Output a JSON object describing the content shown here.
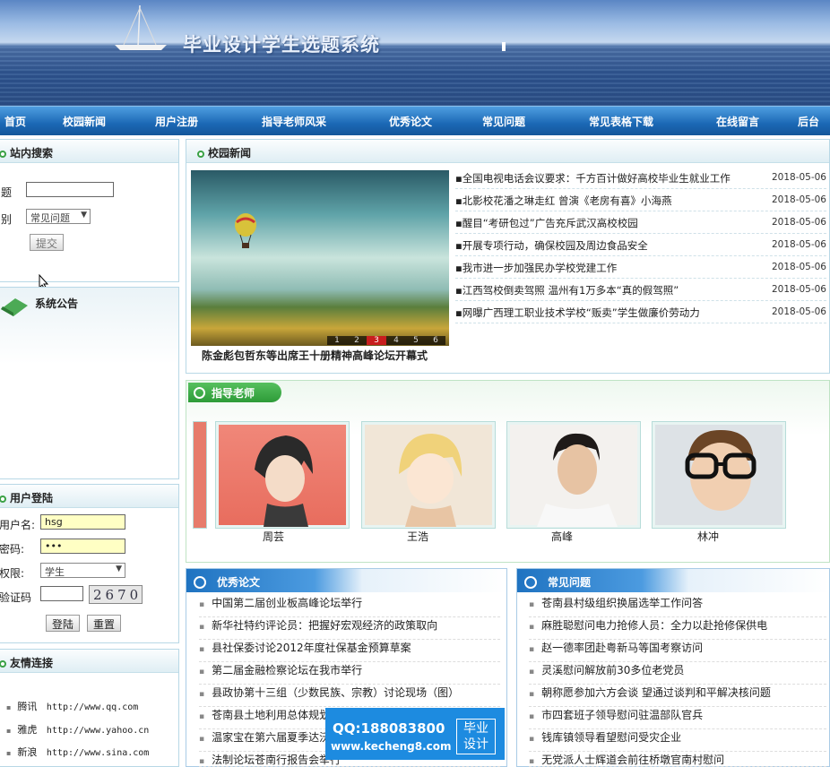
{
  "banner": {
    "title": "毕业设计学生选题系统"
  },
  "nav": [
    "首页",
    "校园新闻",
    "用户注册",
    "指导老师风采",
    "优秀论文",
    "常见问题",
    "常见表格下载",
    "在线留言",
    "后台"
  ],
  "search": {
    "title": "站内搜索",
    "label_title": "题",
    "label_type": "别",
    "type_value": "常见问题",
    "submit": "提交"
  },
  "notice": {
    "title": "系统公告"
  },
  "login": {
    "title": "用户登陆",
    "user_label": "用户名:",
    "user_value": "hsg",
    "pwd_label": "密码:",
    "pwd_value": "•••",
    "role_label": "权限:",
    "role_value": "学生",
    "code_label": "验证码",
    "captcha": "2670",
    "login_btn": "登陆",
    "reset_btn": "重置"
  },
  "links": {
    "title": "友情连接",
    "items": [
      {
        "name": "腾讯",
        "url": "http://www.qq.com"
      },
      {
        "name": "雅虎",
        "url": "http://www.yahoo.cn"
      },
      {
        "name": "新浪",
        "url": "http://www.sina.com"
      }
    ]
  },
  "news": {
    "title": "校园新闻",
    "caption": "陈金彪包哲东等出席王十册精神高峰论坛开幕式",
    "pager": [
      "1",
      "2",
      "3",
      "4",
      "5",
      "6"
    ],
    "items": [
      {
        "t": "▪全国电视电话会议要求：千方百计做好高校毕业生就业工作",
        "d": "2018-05-06"
      },
      {
        "t": "▪北影校花潘之琳走红 曾演《老房有喜》小海燕",
        "d": "2018-05-06"
      },
      {
        "t": "▪醒目“考研包过”广告充斥武汉高校校园",
        "d": "2018-05-06"
      },
      {
        "t": "▪开展专项行动，确保校园及周边食品安全",
        "d": "2018-05-06"
      },
      {
        "t": "▪我市进一步加强民办学校党建工作",
        "d": "2018-05-06"
      },
      {
        "t": "▪江西驾校倒卖驾照 温州有1万多本“真的假驾照”",
        "d": "2018-05-06"
      },
      {
        "t": "▪网曝广西理工职业技术学校“贩卖”学生做廉价劳动力",
        "d": "2018-05-06"
      }
    ]
  },
  "teachers": {
    "title": "指导老师",
    "names": [
      "周芸",
      "王浩",
      "高峰",
      "林冲"
    ]
  },
  "papers": {
    "title": "优秀论文",
    "items": [
      "中国第二届创业板高峰论坛举行",
      "新华社特约评论员：把握好宏观经济的政策取向",
      "县社保委讨论2012年度社保基金预算草案",
      "第二届金融检察论坛在我市举行",
      "县政协第十三组（少数民族、宗教）讨论现场（图）",
      "苍南县土地利用总体规划",
      "温家宝在第六届夏季达沃斯",
      "法制论坛苍南行报告会举行"
    ]
  },
  "faq": {
    "title": "常见问题",
    "items": [
      "苍南县村级组织换届选举工作问答",
      "麻胜聪慰问电力抢修人员：全力以赴抢修保供电",
      "赵一德率团赴粤新马等国考察访问",
      "灵溪慰问解放前30多位老党员",
      "朝称愿参加六方会谈 望通过谈判和平解决核问题",
      "市四套班子领导慰问驻温部队官兵",
      "钱库镇领导看望慰问受灾企业",
      "无党派人士辉道会前往桥墩官南村慰问"
    ]
  },
  "watermark": {
    "qq": "QQ:188083800",
    "site": "www.kecheng8.com",
    "tag1": "毕业",
    "tag2": "设计"
  }
}
